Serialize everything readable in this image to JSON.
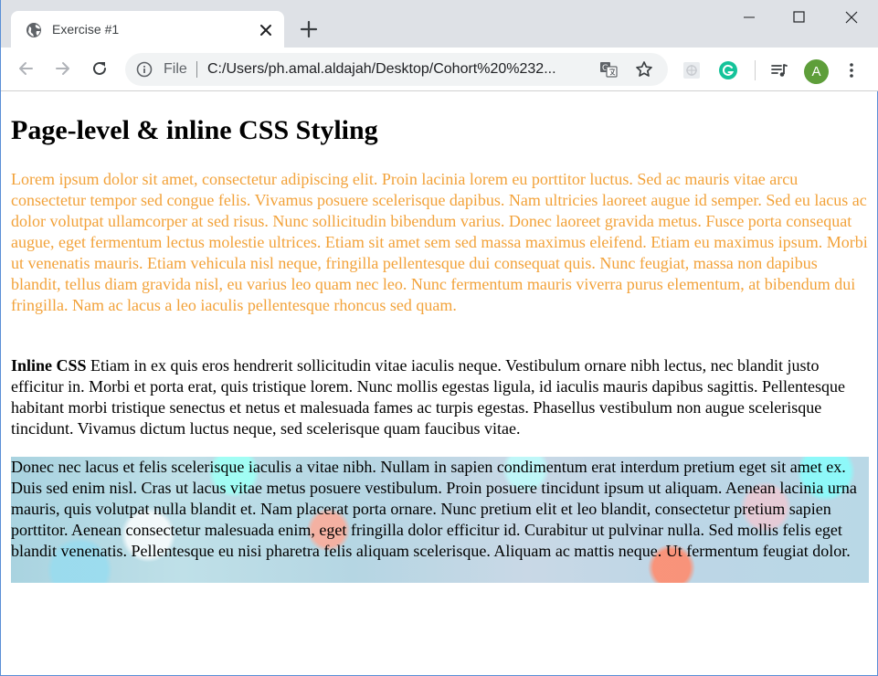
{
  "browser": {
    "tab_title": "Exercise #1",
    "omnibox_file_label": "File",
    "omnibox_url": "C:/Users/ph.amal.aldajah/Desktop/Cohort%20%232...",
    "avatar_letter": "A"
  },
  "page": {
    "heading": "Page-level & inline CSS Styling",
    "paragraph_orange": "Lorem ipsum dolor sit amet, consectetur adipiscing elit. Proin lacinia lorem eu porttitor luctus. Sed ac mauris vitae arcu consectetur tempor sed congue felis. Vivamus posuere scelerisque dapibus. Nam ultricies laoreet augue id semper. Sed eu lacus ac dolor volutpat ullamcorper at sed risus. Nunc sollicitudin bibendum varius. Donec laoreet gravida metus. Fusce porta consequat augue, eget fermentum lectus molestie ultrices. Etiam sit amet sem sed massa maximus eleifend. Etiam eu maximus ipsum. Morbi ut venenatis mauris. Etiam vehicula nisl neque, fringilla pellentesque dui consequat quis. Nunc feugiat, massa non dapibus blandit, tellus diam gravida nisl, eu varius leo quam nec leo. Nunc fermentum mauris viverra purus elementum, at bibendum dui fringilla. Nam ac lacus a leo iaculis pellentesque rhoncus sed quam.",
    "inline_label": "Inline CSS",
    "paragraph_inline": " Etiam in ex quis eros hendrerit sollicitudin vitae iaculis neque. Vestibulum ornare nibh lectus, nec blandit justo efficitur in. Morbi et porta erat, quis tristique lorem. Nunc mollis egestas ligula, id iaculis mauris dapibus sagittis. Pellentesque habitant morbi tristique senectus et netus et malesuada fames ac turpis egestas. Phasellus vestibulum non augue scelerisque tincidunt. Vivamus dictum luctus neque, sed scelerisque quam faucibus vitae.",
    "paragraph_background": "Donec nec lacus et felis scelerisque iaculis a vitae nibh. Nullam in sapien condimentum erat interdum pretium eget sit amet ex. Duis sed enim nisl. Cras ut lacus vitae metus posuere vestibulum. Proin posuere tincidunt ipsum ut aliquam. Aenean lacinia urna mauris, quis volutpat nulla blandit et. Nam placerat porta ornare. Nunc pretium elit et leo blandit, consectetur pretium sapien porttitor. Aenean consectetur malesuada enim, eget fringilla dolor efficitur id. Curabitur ut pulvinar nulla. Sed mollis felis eget blandit venenatis. Pellentesque eu nisi pharetra felis aliquam scelerisque. Aliquam ac mattis neque. Ut fermentum feugiat dolor."
  },
  "colors": {
    "orange_text": "#f2a23a",
    "tabstrip_bg": "#dee1e6",
    "omnibox_bg": "#f1f3f4",
    "avatar_bg": "#5e9e3a",
    "grammarly": "#15c39a"
  },
  "icons": [
    "globe-icon",
    "close-icon",
    "plus-icon",
    "minimize-icon",
    "maximize-icon",
    "window-close-icon",
    "back-arrow-icon",
    "forward-arrow-icon",
    "reload-icon",
    "info-icon",
    "translate-icon",
    "star-icon",
    "extension-icon",
    "grammarly-icon",
    "media-control-icon",
    "kebab-menu-icon"
  ]
}
